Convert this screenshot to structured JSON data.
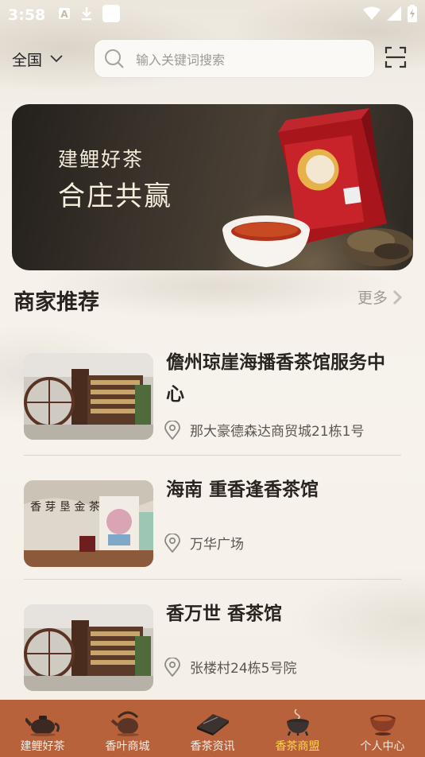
{
  "status": {
    "time": "3:58",
    "icons": [
      "a-icon",
      "download-icon",
      "square-icon",
      "wifi-icon",
      "signal-icon",
      "battery-icon"
    ]
  },
  "header": {
    "region": "全国",
    "search_placeholder": "输入关键词搜索"
  },
  "banner": {
    "subtitle": "建鲤好茶",
    "title": "合庄共赢"
  },
  "section": {
    "title": "商家推荐",
    "more": "更多"
  },
  "shops": [
    {
      "name": "儋州琼崖海播香茶馆服务中心",
      "address": "那大豪德森达商贸城21栋1号"
    },
    {
      "name": "海南 重香逢香茶馆",
      "address": "万华广场"
    },
    {
      "name": "香万世 香茶馆",
      "address": "张楼村24栋5号院"
    }
  ],
  "tabs": [
    {
      "label": "建鲤好茶",
      "icon": "teapot-icon"
    },
    {
      "label": "香叶商城",
      "icon": "kettle-icon"
    },
    {
      "label": "香茶资讯",
      "icon": "book-icon"
    },
    {
      "label": "香茶商盟",
      "icon": "incense-burner-icon"
    },
    {
      "label": "个人中心",
      "icon": "tea-cup-icon"
    }
  ],
  "active_tab": "香茶商盟",
  "colors": {
    "tabbar": "#b8623c",
    "tab_active": "#ffd34d",
    "banner_red": "#c8232b"
  }
}
